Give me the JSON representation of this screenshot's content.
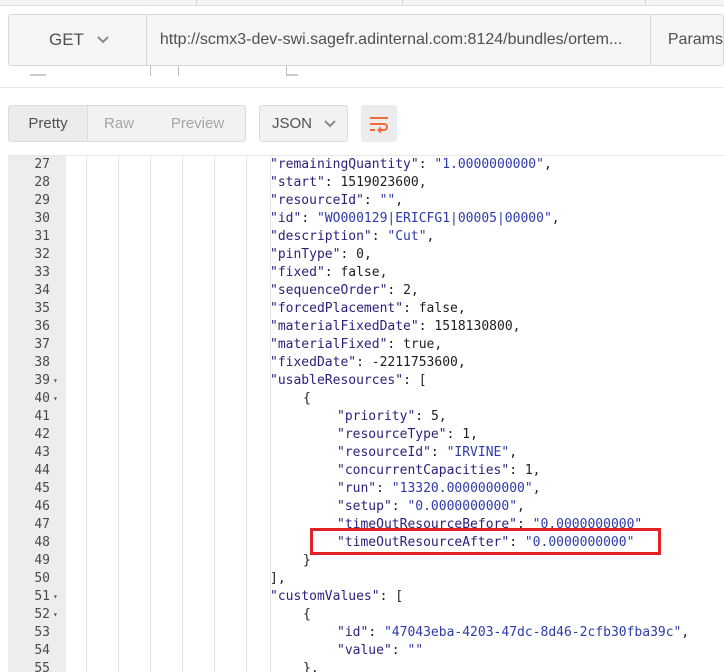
{
  "request": {
    "method": "GET",
    "url": "http://scmx3-dev-swi.sagefr.adinternal.com:8124/bundles/ortem...",
    "params_label": "Params"
  },
  "response_toolbar": {
    "views": [
      "Pretty",
      "Raw",
      "Preview"
    ],
    "active_view": "Pretty",
    "format": "JSON"
  },
  "icons": {
    "method_dropdown": "chevron-down-icon",
    "format_dropdown": "chevron-down-icon",
    "wrap": "wrap-lines-icon",
    "fold": "fold-arrow-icon"
  },
  "colors": {
    "key": "#2b1f7a",
    "string": "#2e3ba8",
    "wrap_icon": "#f26b3a",
    "highlight_box": "#e32226"
  },
  "code_lines": [
    {
      "n": "27",
      "fold": false,
      "parts": [
        [
          "k",
          "\"remainingQuantity\""
        ],
        [
          "p",
          ": "
        ],
        [
          "s",
          "\"1.0000000000\""
        ],
        [
          "p",
          ","
        ]
      ]
    },
    {
      "n": "28",
      "fold": false,
      "parts": [
        [
          "k",
          "\"start\""
        ],
        [
          "p",
          ": "
        ],
        [
          "n",
          "1519023600"
        ],
        [
          "p",
          ","
        ]
      ]
    },
    {
      "n": "29",
      "fold": false,
      "parts": [
        [
          "k",
          "\"resourceId\""
        ],
        [
          "p",
          ": "
        ],
        [
          "s",
          "\"\""
        ],
        [
          "p",
          ","
        ]
      ]
    },
    {
      "n": "30",
      "fold": false,
      "parts": [
        [
          "k",
          "\"id\""
        ],
        [
          "p",
          ": "
        ],
        [
          "s",
          "\"WO000129|ERICFG1|00005|00000\""
        ],
        [
          "p",
          ","
        ]
      ]
    },
    {
      "n": "31",
      "fold": false,
      "parts": [
        [
          "k",
          "\"description\""
        ],
        [
          "p",
          ": "
        ],
        [
          "s",
          "\"Cut\""
        ],
        [
          "p",
          ","
        ]
      ]
    },
    {
      "n": "32",
      "fold": false,
      "parts": [
        [
          "k",
          "\"pinType\""
        ],
        [
          "p",
          ": "
        ],
        [
          "n",
          "0"
        ],
        [
          "p",
          ","
        ]
      ]
    },
    {
      "n": "33",
      "fold": false,
      "parts": [
        [
          "k",
          "\"fixed\""
        ],
        [
          "p",
          ": "
        ],
        [
          "n",
          "false"
        ],
        [
          "p",
          ","
        ]
      ]
    },
    {
      "n": "34",
      "fold": false,
      "parts": [
        [
          "k",
          "\"sequenceOrder\""
        ],
        [
          "p",
          ": "
        ],
        [
          "n",
          "2"
        ],
        [
          "p",
          ","
        ]
      ]
    },
    {
      "n": "35",
      "fold": false,
      "parts": [
        [
          "k",
          "\"forcedPlacement\""
        ],
        [
          "p",
          ": "
        ],
        [
          "n",
          "false"
        ],
        [
          "p",
          ","
        ]
      ]
    },
    {
      "n": "36",
      "fold": false,
      "parts": [
        [
          "k",
          "\"materialFixedDate\""
        ],
        [
          "p",
          ": "
        ],
        [
          "n",
          "1518130800"
        ],
        [
          "p",
          ","
        ]
      ]
    },
    {
      "n": "37",
      "fold": false,
      "parts": [
        [
          "k",
          "\"materialFixed\""
        ],
        [
          "p",
          ": "
        ],
        [
          "n",
          "true"
        ],
        [
          "p",
          ","
        ]
      ]
    },
    {
      "n": "38",
      "fold": false,
      "parts": [
        [
          "k",
          "\"fixedDate\""
        ],
        [
          "p",
          ": "
        ],
        [
          "n",
          "-2211753600"
        ],
        [
          "p",
          ","
        ]
      ]
    },
    {
      "n": "39",
      "fold": true,
      "parts": [
        [
          "k",
          "\"usableResources\""
        ],
        [
          "p",
          ": ["
        ]
      ]
    },
    {
      "n": "40",
      "fold": true,
      "parts": [
        [
          "p",
          "{"
        ]
      ]
    },
    {
      "n": "41",
      "fold": false,
      "parts": [
        [
          "k",
          "\"priority\""
        ],
        [
          "p",
          ": "
        ],
        [
          "n",
          "5"
        ],
        [
          "p",
          ","
        ]
      ]
    },
    {
      "n": "42",
      "fold": false,
      "parts": [
        [
          "k",
          "\"resourceType\""
        ],
        [
          "p",
          ": "
        ],
        [
          "n",
          "1"
        ],
        [
          "p",
          ","
        ]
      ]
    },
    {
      "n": "43",
      "fold": false,
      "parts": [
        [
          "k",
          "\"resourceId\""
        ],
        [
          "p",
          ": "
        ],
        [
          "s",
          "\"IRVINE\""
        ],
        [
          "p",
          ","
        ]
      ]
    },
    {
      "n": "44",
      "fold": false,
      "parts": [
        [
          "k",
          "\"concurrentCapacities\""
        ],
        [
          "p",
          ": "
        ],
        [
          "n",
          "1"
        ],
        [
          "p",
          ","
        ]
      ]
    },
    {
      "n": "45",
      "fold": false,
      "parts": [
        [
          "k",
          "\"run\""
        ],
        [
          "p",
          ": "
        ],
        [
          "s",
          "\"13320.0000000000\""
        ],
        [
          "p",
          ","
        ]
      ]
    },
    {
      "n": "46",
      "fold": false,
      "parts": [
        [
          "k",
          "\"setup\""
        ],
        [
          "p",
          ": "
        ],
        [
          "s",
          "\"0.0000000000\""
        ],
        [
          "p",
          ","
        ]
      ]
    },
    {
      "n": "47",
      "fold": false,
      "parts": [
        [
          "k",
          "\"timeOutResourceBefore\""
        ],
        [
          "p",
          ": "
        ],
        [
          "s",
          "\"0.0000000000\""
        ]
      ]
    },
    {
      "n": "48",
      "fold": false,
      "parts": [
        [
          "k",
          "\"timeOutResourceAfter\""
        ],
        [
          "p",
          ": "
        ],
        [
          "s",
          "\"0.0000000000\""
        ]
      ]
    },
    {
      "n": "49",
      "fold": false,
      "parts": [
        [
          "p",
          "}"
        ]
      ]
    },
    {
      "n": "50",
      "fold": false,
      "parts": [
        [
          "p",
          "],"
        ]
      ]
    },
    {
      "n": "51",
      "fold": true,
      "parts": [
        [
          "k",
          "\"customValues\""
        ],
        [
          "p",
          ": ["
        ]
      ]
    },
    {
      "n": "52",
      "fold": true,
      "parts": [
        [
          "p",
          "{"
        ]
      ]
    },
    {
      "n": "53",
      "fold": false,
      "parts": [
        [
          "k",
          "\"id\""
        ],
        [
          "p",
          ": "
        ],
        [
          "s",
          "\"47043eba-4203-47dc-8d46-2cfb30fba39c\""
        ],
        [
          "p",
          ","
        ]
      ]
    },
    {
      "n": "54",
      "fold": false,
      "parts": [
        [
          "k",
          "\"value\""
        ],
        [
          "p",
          ": "
        ],
        [
          "s",
          "\"\""
        ]
      ]
    },
    {
      "n": "55",
      "fold": false,
      "parts": [
        [
          "p",
          "},"
        ]
      ]
    }
  ]
}
